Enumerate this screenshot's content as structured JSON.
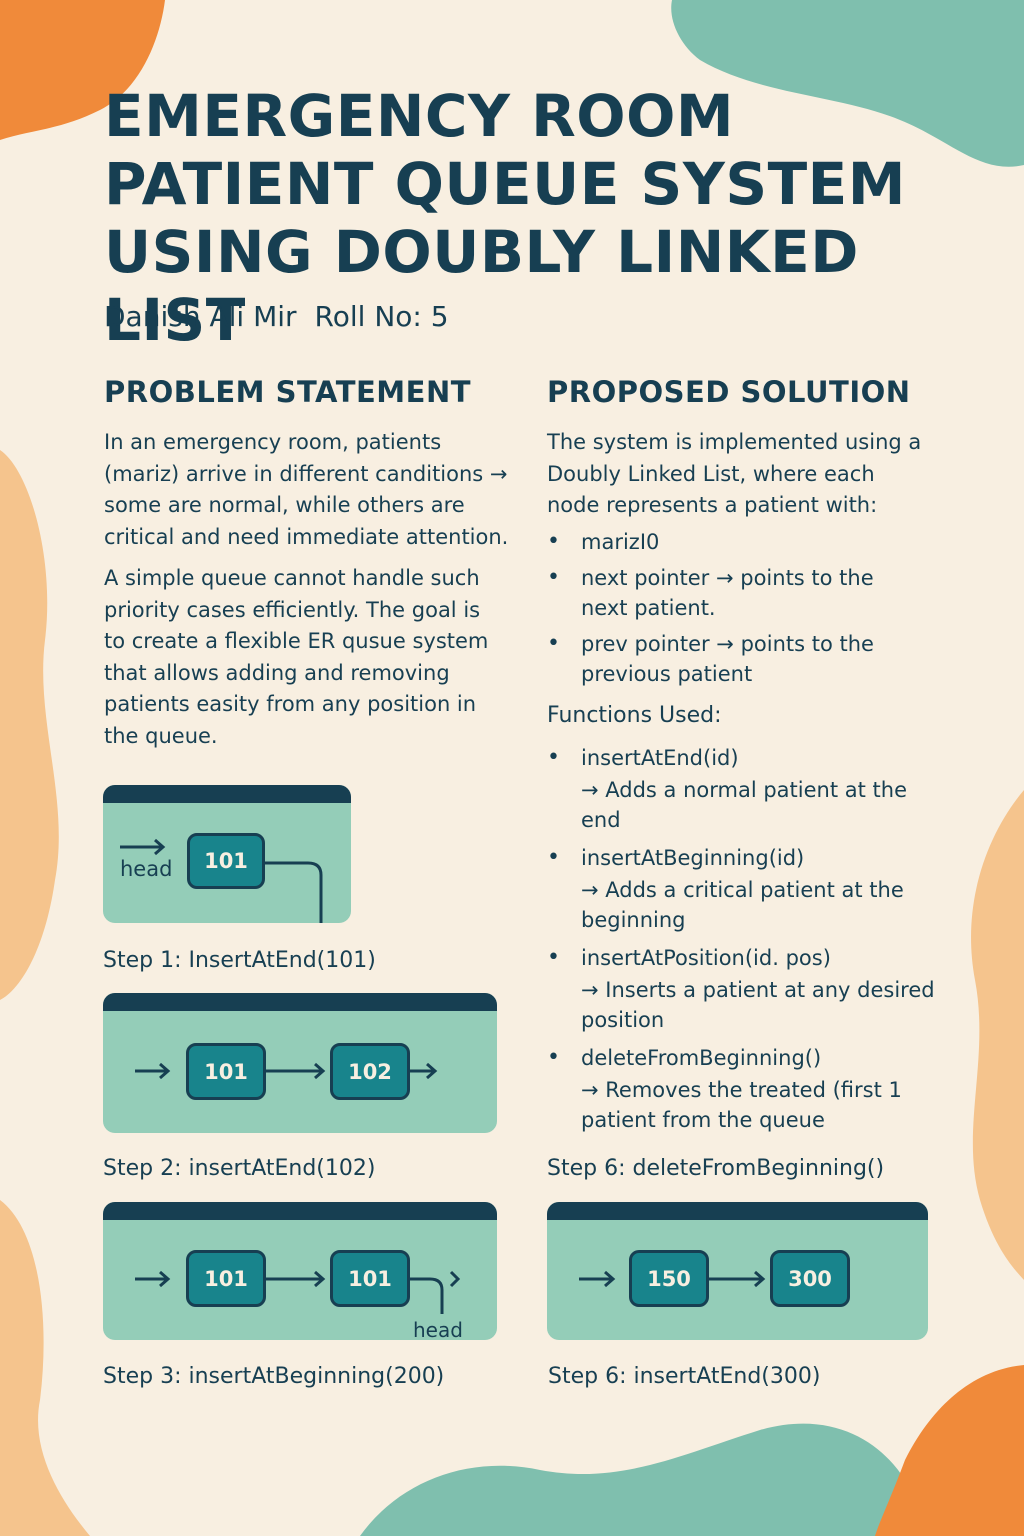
{
  "title": {
    "line1": "EMERGENCY ROOM",
    "line2": "PATIENT QUEUE SYSTEM",
    "line3": "USING DOUBLY LINKED LIST"
  },
  "author": {
    "name": "Danish Ali Mir",
    "roll": "Roll No: 5"
  },
  "problem": {
    "heading": "PROBLEM STATEMENT",
    "para1": "In an emergency room, patients (mariz) arrive in different canditions → some are normal, while others are critical and need immediate attention.",
    "para2": "A simple queue cannot handle such priority cases efficiently. The goal is to create a flexible ER qusue system that allows adding and removing patients easity from any position in the queue."
  },
  "solution": {
    "heading": "PROPOSED SOLUTION",
    "intro": "The system is implemented using a Doubly Linked List, where each node represents a patient with:",
    "fields": [
      "marizI0",
      "next pointer → points to the next patient.",
      "prev pointer → points to the previous patient"
    ],
    "functions_heading": "Functions Used:",
    "functions": [
      {
        "name": "insertAtEnd(id)",
        "desc": "→ Adds a normal patient at the end"
      },
      {
        "name": "insertAtBeginning(id)",
        "desc": "→ Adds a critical patient at the beginning"
      },
      {
        "name": "insertAtPosition(id. pos)",
        "desc": "→ Inserts a patient at any  desired position"
      },
      {
        "name": "deleteFromBeginning()",
        "desc": "→ Removes the treated (first 1 patient from the queue"
      }
    ]
  },
  "steps": {
    "s1": {
      "caption": "Step 1: InsertAtEnd(101)",
      "nodes": [
        "101"
      ],
      "label": "head"
    },
    "s2": {
      "caption": "Step 2: insertAtEnd(102)",
      "nodes": [
        "101",
        "102"
      ]
    },
    "s3": {
      "caption": "Step 3: insertAtBeginning(200)",
      "nodes": [
        "101",
        "101"
      ],
      "label": "head"
    },
    "s6a": {
      "caption": "Step 6: deleteFromBeginning()"
    },
    "s6b": {
      "caption": "Step 6: insertAtEnd(300)",
      "nodes": [
        "150",
        "300"
      ]
    }
  },
  "colors": {
    "background": "#f8efe1",
    "navy": "#173f52",
    "panel": "#94cdb8",
    "node": "#18848c",
    "orange": "#f08a3a",
    "peach": "#f5c48d",
    "teal": "#7fbfae"
  }
}
